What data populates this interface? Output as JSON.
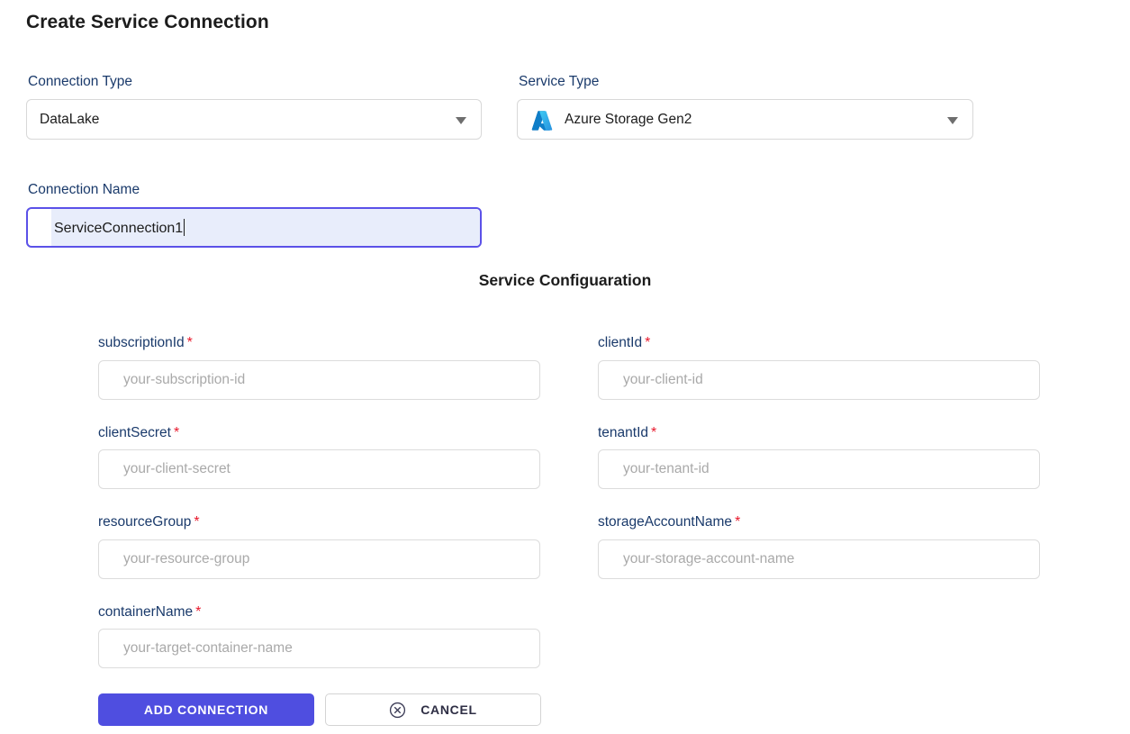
{
  "page_title": "Create Service Connection",
  "connection_type": {
    "label": "Connection Type",
    "value": "DataLake"
  },
  "service_type": {
    "label": "Service Type",
    "value": "Azure Storage Gen2",
    "icon": "azure-logo-icon"
  },
  "connection_name": {
    "label": "Connection Name",
    "value": "ServiceConnection1"
  },
  "section_heading": "Service Configuaration",
  "config_fields": [
    [
      {
        "label": "subscriptionId",
        "required": "*",
        "placeholder": "your-subscription-id",
        "value": "",
        "name": "subscription-id"
      },
      {
        "label": "clientId",
        "required": "*",
        "placeholder": "your-client-id",
        "value": "",
        "name": "client-id"
      }
    ],
    [
      {
        "label": "clientSecret",
        "required": "*",
        "placeholder": "your-client-secret",
        "value": "",
        "name": "client-secret"
      },
      {
        "label": "tenantId",
        "required": "*",
        "placeholder": "your-tenant-id",
        "value": "",
        "name": "tenant-id"
      }
    ],
    [
      {
        "label": "resourceGroup",
        "required": "*",
        "placeholder": "your-resource-group",
        "value": "",
        "name": "resource-group"
      },
      {
        "label": "storageAccountName",
        "required": "*",
        "placeholder": "your-storage-account-name",
        "value": "",
        "name": "storage-account-name"
      }
    ],
    [
      {
        "label": "containerName",
        "required": "*",
        "placeholder": "your-target-container-name",
        "value": "",
        "name": "container-name"
      },
      null
    ]
  ],
  "buttons": {
    "submit": "ADD CONNECTION",
    "cancel": "CANCEL",
    "cancel_icon": "circle-x-icon"
  },
  "colors": {
    "label_blue": "#1a3a6b",
    "required_red": "#e8192c",
    "primary_button": "#4f4ee0",
    "focus_border": "#5b51e8",
    "autofill_bg": "#e8edfb",
    "azure_blue": "#0f78d4",
    "cancel_icon": "#3b3b55"
  }
}
